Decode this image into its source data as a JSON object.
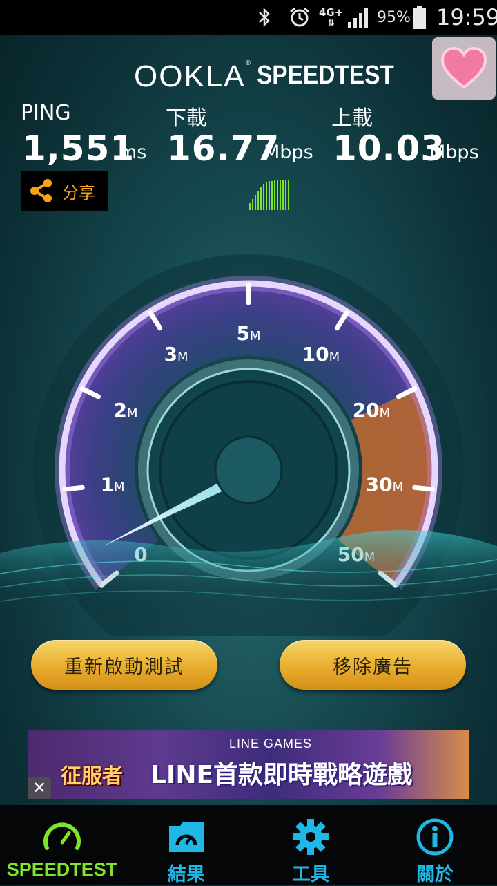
{
  "status_bar": {
    "network": "4G+",
    "battery_percent": "95%",
    "time": "19:59"
  },
  "header": {
    "logo": "OOKLA",
    "logo_mark": "®",
    "product": "SPEEDTEST"
  },
  "results": {
    "ping": {
      "label": "PING",
      "value": "1,551",
      "unit": "ms"
    },
    "download": {
      "label": "下載",
      "value": "16.77",
      "unit": "Mbps"
    },
    "upload": {
      "label": "上載",
      "value": "10.03",
      "unit": "Mbps"
    }
  },
  "share_label": "分享",
  "gauge": {
    "ticks": [
      {
        "num": "0",
        "unit": ""
      },
      {
        "num": "1",
        "unit": "M"
      },
      {
        "num": "2",
        "unit": "M"
      },
      {
        "num": "3",
        "unit": "M"
      },
      {
        "num": "5",
        "unit": "M"
      },
      {
        "num": "10",
        "unit": "M"
      },
      {
        "num": "20",
        "unit": "M"
      },
      {
        "num": "30",
        "unit": "M"
      },
      {
        "num": "50",
        "unit": "M"
      }
    ],
    "needle_value_mbps": 0
  },
  "buttons": {
    "restart": "重新啟動測試",
    "remove_ads": "移除廣告"
  },
  "ad": {
    "sub": "LINE GAMES",
    "main": "LINE首款即時戰略遊戲",
    "logo_text": "征服者",
    "close": "✕"
  },
  "nav": {
    "speedtest": "SPEEDTEST",
    "results": "結果",
    "tools": "工具",
    "about": "關於"
  },
  "colors": {
    "accent_green": "#7fe52a",
    "accent_blue": "#1eb7e6",
    "share_orange": "#f6a21a",
    "gauge_purple": "#8a5cd6"
  }
}
